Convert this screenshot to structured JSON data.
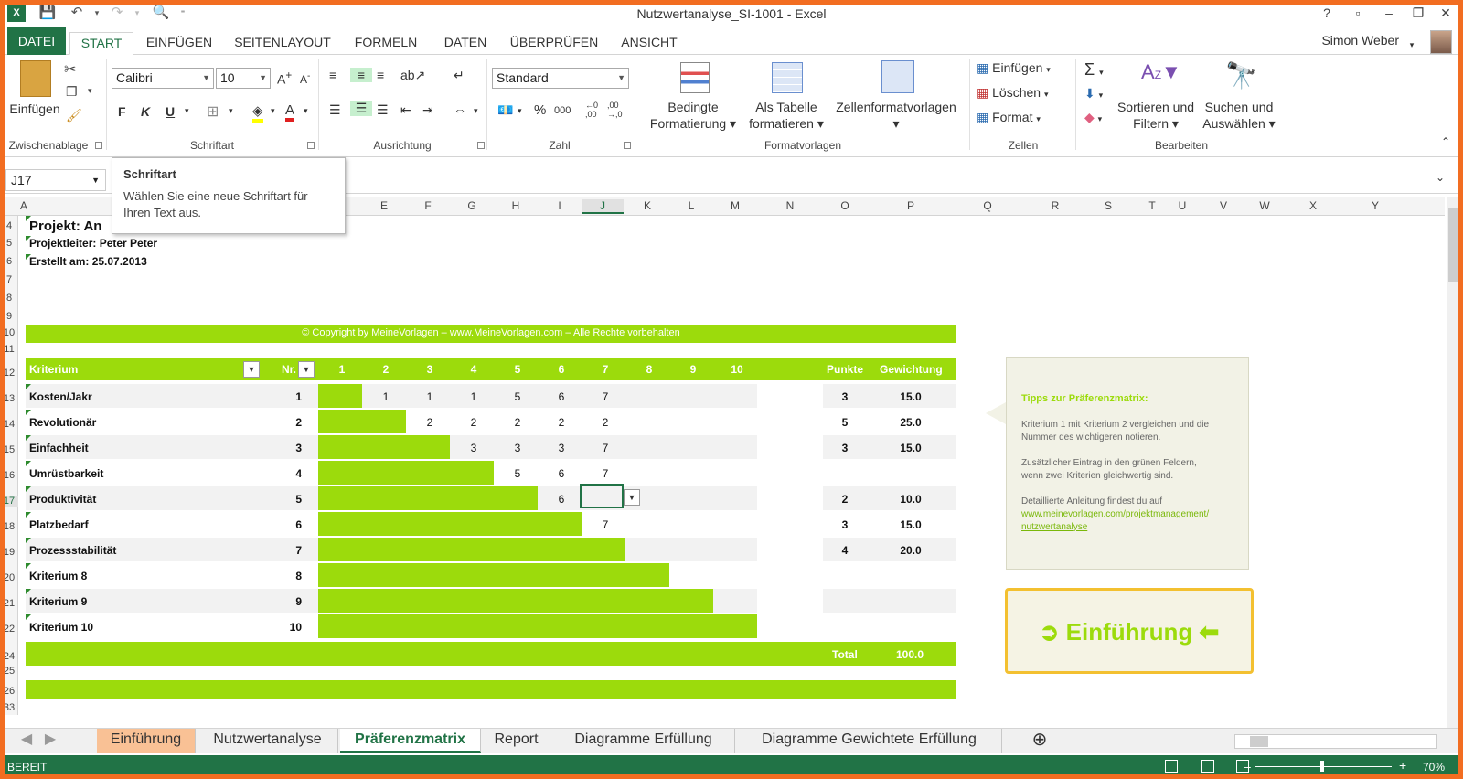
{
  "app": {
    "title": "Nutzwertanalyse_SI-1001 - Excel",
    "user": "Simon Weber"
  },
  "title_controls": {
    "help": "?",
    "restore": "▫",
    "minimize": "–",
    "maximize": "❐",
    "close": "✕"
  },
  "ribbon_tabs": [
    "DATEI",
    "START",
    "EINFÜGEN",
    "SEITENLAYOUT",
    "FORMELN",
    "DATEN",
    "ÜBERPRÜFEN",
    "ANSICHT"
  ],
  "ribbon": {
    "clipboard": {
      "paste": "Einfügen",
      "label": "Zwischenablage"
    },
    "font": {
      "name": "Calibri",
      "size": "10",
      "bold": "F",
      "italic": "K",
      "underline": "U",
      "label": "Schriftart"
    },
    "alignment": {
      "label": "Ausrichtung"
    },
    "number": {
      "format": "Standard",
      "percent": "%",
      "thousands": "000",
      "label": "Zahl"
    },
    "styles": {
      "conditional": "Bedingte",
      "conditional2": "Formatierung",
      "astable": "Als Tabelle",
      "astable2": "formatieren",
      "cellstyles": "Zellenformatvorlagen",
      "label": "Formatvorlagen"
    },
    "cells": {
      "insert": "Einfügen",
      "delete": "Löschen",
      "format": "Format",
      "label": "Zellen"
    },
    "editing": {
      "sort": "Sortieren und",
      "sort2": "Filtern",
      "find": "Suchen und",
      "find2": "Auswählen",
      "label": "Bearbeiten"
    }
  },
  "namebox": "J17",
  "tooltip": {
    "title": "Schriftart",
    "line1": "Wählen Sie eine neue Schriftart für",
    "line2": "Ihren Text aus."
  },
  "columns": [
    "A",
    "E",
    "F",
    "G",
    "H",
    "I",
    "J",
    "K",
    "L",
    "M",
    "N",
    "O",
    "P",
    "Q",
    "R",
    "S",
    "T",
    "U",
    "V",
    "W",
    "X",
    "Y"
  ],
  "rows": [
    "4",
    "5",
    "6",
    "7",
    "8",
    "9",
    "10",
    "11",
    "12",
    "13",
    "14",
    "15",
    "16",
    "17",
    "18",
    "19",
    "20",
    "21",
    "22",
    "24",
    "25",
    "26",
    "33"
  ],
  "sheet": {
    "project": "Projekt: An",
    "leader": "Projektleiter: Peter Peter",
    "created": "Erstellt am: 25.07.2013",
    "copyright": "© Copyright by MeineVorlagen – www.MeineVorlagen.com – Alle Rechte vorbehalten",
    "headers": {
      "kriterium": "Kriterium",
      "nr": "Nr.",
      "nums": [
        "1",
        "2",
        "3",
        "4",
        "5",
        "6",
        "7",
        "8",
        "9",
        "10"
      ],
      "punkte": "Punkte",
      "gewichtung": "Gewichtung"
    },
    "total_label": "Total",
    "total_value": "100.0",
    "criteria": [
      {
        "name": "Kosten/Jakr",
        "nr": "1",
        "bar_cols": 1,
        "vals": [
          "1",
          "1",
          "1",
          "5",
          "6",
          "7"
        ],
        "punkte": "3",
        "gew": "15.0"
      },
      {
        "name": "Revolutionär",
        "nr": "2",
        "bar_cols": 2,
        "vals": [
          "2",
          "2",
          "2",
          "2",
          "2"
        ],
        "punkte": "5",
        "gew": "25.0"
      },
      {
        "name": "Einfachheit",
        "nr": "3",
        "bar_cols": 3,
        "vals": [
          "3",
          "3",
          "3",
          "7"
        ],
        "punkte": "3",
        "gew": "15.0"
      },
      {
        "name": "Umrüstbarkeit",
        "nr": "4",
        "bar_cols": 4,
        "vals": [
          "5",
          "6",
          "7"
        ],
        "punkte": "",
        "gew": ""
      },
      {
        "name": "Produktivität",
        "nr": "5",
        "bar_cols": 5,
        "vals": [
          "6",
          ""
        ],
        "punkte": "2",
        "gew": "10.0"
      },
      {
        "name": "Platzbedarf",
        "nr": "6",
        "bar_cols": 6,
        "vals": [
          "7"
        ],
        "punkte": "3",
        "gew": "15.0"
      },
      {
        "name": "Prozessstabilität",
        "nr": "7",
        "bar_cols": 7,
        "vals": [],
        "punkte": "4",
        "gew": "20.0"
      },
      {
        "name": "Kriterium 8",
        "nr": "8",
        "bar_cols": 8,
        "vals": [],
        "punkte": "",
        "gew": ""
      },
      {
        "name": "Kriterium 9",
        "nr": "9",
        "bar_cols": 9,
        "vals": [],
        "punkte": "",
        "gew": ""
      },
      {
        "name": "Kriterium 10",
        "nr": "10",
        "bar_cols": 10,
        "vals": [],
        "punkte": "",
        "gew": ""
      }
    ]
  },
  "tips": {
    "title": "Tipps zur Präferenzmatrix:",
    "p1a": "Kriterium 1 mit Kriterium 2 vergleichen und die",
    "p1b": "Nummer des wichtigeren notieren.",
    "p2a": "Zusätzlicher Eintrag in den grünen Feldern,",
    "p2b": "wenn zwei Kriterien gleichwertig sind.",
    "p3": "Detaillierte Anleitung findest du auf",
    "link1": "www.meinevorlagen.com/projektmanagement/",
    "link2": "nutzwertanalyse"
  },
  "intro_button": "Einführung",
  "sheet_tabs": [
    "Einführung",
    "Nutzwertanalyse",
    "Präferenzmatrix",
    "Report",
    "Diagramme Erfüllung",
    "Diagramme Gewichtete Erfüllung"
  ],
  "status": {
    "ready": "BEREIT",
    "zoom": "70%"
  },
  "colors": {
    "excel_green": "#217346",
    "lime": "#9cdb0c",
    "frame_orange": "#f26d21",
    "tab_orange": "#f9c195"
  }
}
